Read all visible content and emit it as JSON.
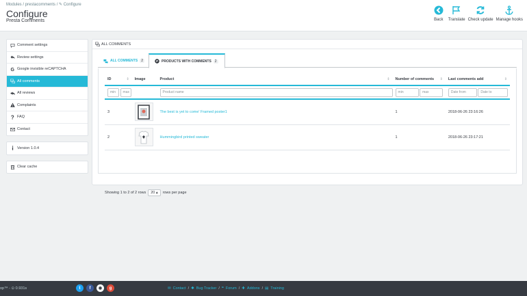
{
  "header": {
    "breadcrumb": "Modules  /  prestacomments  /  ✎ Configure",
    "title": "Configure",
    "subtitle": "Presta Comments",
    "toolbar": [
      {
        "label": "Back",
        "icon": "back-icon"
      },
      {
        "label": "Translate",
        "icon": "flag-icon"
      },
      {
        "label": "Check update",
        "icon": "refresh-icon"
      },
      {
        "label": "Manage hooks",
        "icon": "anchor-icon"
      }
    ],
    "accent_color": "#25b9d7"
  },
  "sidebar": {
    "items": [
      {
        "label": "Comment settings",
        "icon": "comment-icon"
      },
      {
        "label": "Review settings",
        "icon": "reply-icon"
      },
      {
        "label": "Google invisible reCAPTCHA",
        "icon": "google-icon"
      },
      {
        "label": "All comments",
        "icon": "comments-icon",
        "active": true
      },
      {
        "label": "All reviews",
        "icon": "reply-all-icon"
      },
      {
        "label": "Complaints",
        "icon": "warning-icon"
      },
      {
        "label": "FAQ",
        "icon": "question-icon"
      },
      {
        "label": "Contact",
        "icon": "envelope-icon"
      }
    ],
    "version": "Version 1.0.4",
    "clear_cache": "Clear cache"
  },
  "panel": {
    "title": "ALL COMMENTS",
    "tabs": [
      {
        "label": "ALL COMMENTS",
        "count": "2"
      },
      {
        "label": "PRODUCTS WITH COMMENTS",
        "count": "2",
        "active": true
      }
    ],
    "columns": [
      "ID",
      "Image",
      "Product",
      "Number of comments",
      "Last comments add"
    ],
    "filters": {
      "id_min": "min",
      "id_max": "max",
      "product": "Product name",
      "num_min": "min",
      "num_max": "max",
      "date_from": "Date from",
      "date_to": "Date to"
    },
    "rows": [
      {
        "id": "3",
        "product": "The best is yet to come' Framed poster1",
        "count": "1",
        "date": "2018-06-26 23:16:26"
      },
      {
        "id": "2",
        "product": "Hummingbird printed sweater",
        "count": "1",
        "date": "2018-06-26 23:17:21"
      }
    ],
    "pagination": {
      "showing": "Showing 1 to 2 of 2 rows",
      "per_page": "20",
      "suffix": "rows per page"
    }
  },
  "footer": {
    "left": "op™ - ⊙ 0.931s",
    "links": [
      "Contact",
      "Bug Tracker",
      "Forum",
      "Addons",
      "Training"
    ]
  }
}
